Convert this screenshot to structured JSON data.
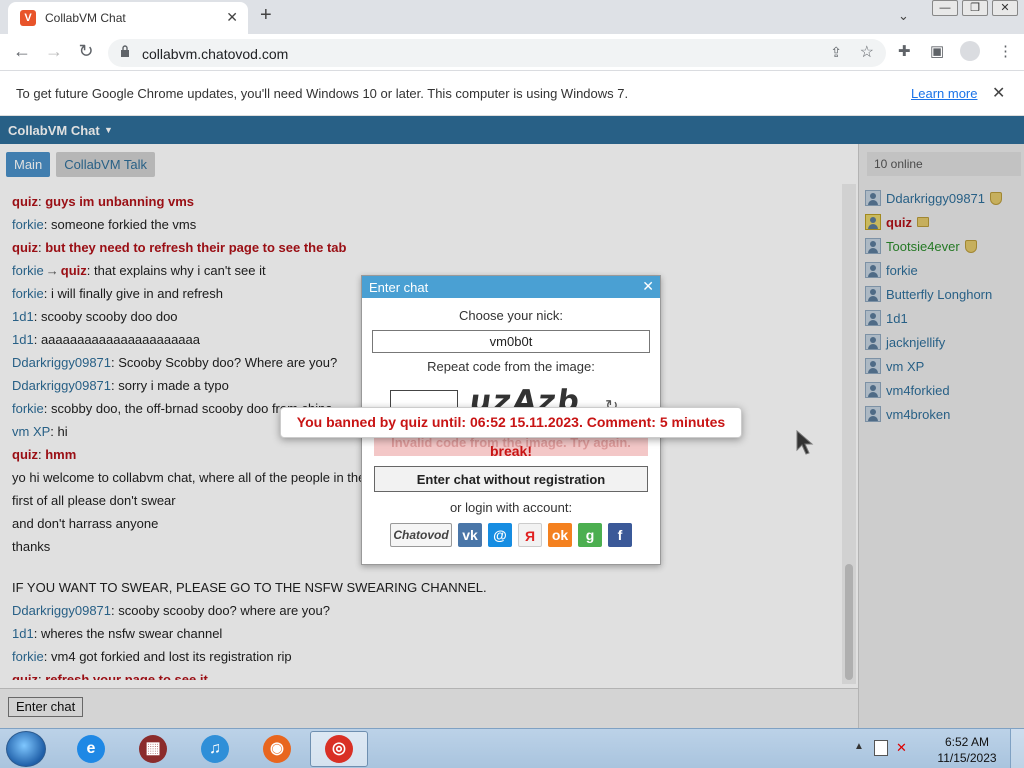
{
  "browser": {
    "tab_title": "CollabVM Chat",
    "tab_close": "✕",
    "new_tab": "+",
    "url": "collabvm.chatovod.com",
    "window_controls": [
      "—",
      "❐",
      "✕"
    ]
  },
  "infobar": {
    "message": "To get future Google Chrome updates, you'll need Windows 10 or later. This computer is using Windows 7.",
    "learn_more": "Learn more",
    "close": "✕"
  },
  "app": {
    "title": "CollabVM Chat",
    "tabs": [
      {
        "label": "Main",
        "active": true
      },
      {
        "label": "CollabVM Talk",
        "active": false
      }
    ],
    "enter_chat_button": "Enter chat",
    "online_count": "10 online"
  },
  "messages": [
    {
      "nick": "quiz",
      "sep": ": ",
      "text": "guys im unbanning vms",
      "style": "red"
    },
    {
      "nick": "forkie",
      "sep": ": ",
      "text": "someone forkied the vms",
      "style": "normal"
    },
    {
      "nick": "quiz",
      "sep": ": ",
      "text": "but they need to refresh their page to see the tab",
      "style": "red"
    },
    {
      "nick": "forkie",
      "arrow": "→",
      "to": "quiz",
      "sep": ": ",
      "text": "that explains why i can't see it",
      "style": "normal"
    },
    {
      "nick": "forkie",
      "sep": ": ",
      "text": "i will finally give in and refresh",
      "style": "normal"
    },
    {
      "nick": "1d1",
      "sep": ": ",
      "text": "scooby scooby doo doo",
      "style": "normal"
    },
    {
      "nick": "1d1",
      "sep": ": ",
      "text": "aaaaaaaaaaaaaaaaaaaaaa",
      "style": "normal"
    },
    {
      "nick": "Ddarkriggy09871",
      "sep": ": ",
      "text": "Scooby Scobby doo? Where are you?",
      "style": "normal"
    },
    {
      "nick": "Ddarkriggy09871",
      "sep": ": ",
      "text": "sorry i made a typo",
      "style": "normal"
    },
    {
      "nick": "forkie",
      "sep": ": ",
      "text": "scobby doo, the off-brnad scooby doo from china",
      "style": "normal"
    },
    {
      "nick": "vm XP",
      "sep": ": ",
      "text": "hi",
      "style": "normal"
    },
    {
      "nick": "quiz",
      "sep": ": ",
      "text": "hmm",
      "style": "red"
    },
    {
      "nick": "",
      "sep": "",
      "text": "yo hi welcome to collabvm chat, where all of the people in the",
      "style": "plain"
    },
    {
      "nick": "",
      "sep": "",
      "text": "first of all please don't swear",
      "style": "plain"
    },
    {
      "nick": "",
      "sep": "",
      "text": "and don't harrass anyone",
      "style": "plain"
    },
    {
      "nick": "",
      "sep": "",
      "text": "thanks",
      "style": "plain"
    },
    {
      "nick": "",
      "sep": "",
      "text": "",
      "style": "gap"
    },
    {
      "nick": "",
      "sep": "",
      "text": "IF YOU WANT TO SWEAR, PLEASE GO TO THE NSFW SWEARING CHANNEL.",
      "style": "plain"
    },
    {
      "nick": "Ddarkriggy09871",
      "sep": ": ",
      "text": "scooby scooby doo? where are you?",
      "style": "normal"
    },
    {
      "nick": "1d1",
      "sep": ": ",
      "text": "wheres the nsfw swear channel",
      "style": "normal"
    },
    {
      "nick": "forkie",
      "sep": ": ",
      "text": "vm4 got forkied and lost its registration rip",
      "style": "normal"
    },
    {
      "nick": "quiz",
      "sep": ": ",
      "text": "refresh your page to see it",
      "style": "red"
    }
  ],
  "users": [
    {
      "name": "Ddarkriggy09871",
      "style": "normal",
      "badge": "shield"
    },
    {
      "name": "quiz",
      "style": "red",
      "badge": "crown"
    },
    {
      "name": "Tootsie4ever",
      "style": "green",
      "badge": "shield"
    },
    {
      "name": "forkie",
      "style": "normal",
      "badge": ""
    },
    {
      "name": "Butterfly Longhorn",
      "style": "normal",
      "badge": ""
    },
    {
      "name": "1d1",
      "style": "normal",
      "badge": ""
    },
    {
      "name": "jacknjellify",
      "style": "normal",
      "badge": ""
    },
    {
      "name": "vm XP",
      "style": "normal",
      "badge": ""
    },
    {
      "name": "vm4forkied",
      "style": "normal",
      "badge": ""
    },
    {
      "name": "vm4broken",
      "style": "normal",
      "badge": ""
    }
  ],
  "dialog": {
    "title": "Enter chat",
    "close": "✕",
    "nick_label": "Choose your nick:",
    "nick_value": "vm0b0t",
    "captcha_label": "Repeat code from the image:",
    "captcha_text": "uzAzb",
    "invalid_msg": "Invalid code from the image. Try again.",
    "enter_no_reg": "Enter chat without registration",
    "or_login": "or login with account:",
    "socials": [
      {
        "name": "chatovod",
        "label": "Chatovod",
        "color": "#f5f5f5"
      },
      {
        "name": "vk",
        "label": "vk",
        "color": "#4a76a8"
      },
      {
        "name": "mailru",
        "label": "@",
        "color": "#168de2"
      },
      {
        "name": "yandex",
        "label": "Я",
        "color": "#f2f2f2"
      },
      {
        "name": "odnoklassniki",
        "label": "ok",
        "color": "#f4811f"
      },
      {
        "name": "google",
        "label": "g",
        "color": "#4caf50"
      },
      {
        "name": "facebook",
        "label": "f",
        "color": "#3b5998"
      }
    ]
  },
  "ban_message": "You banned by quiz until: 06:52 15.11.2023. Comment: 5 minutes break!",
  "taskbar": {
    "apps": [
      {
        "name": "internet-explorer",
        "color": "#1e88e5",
        "glyph": "e",
        "active": false
      },
      {
        "name": "media-center",
        "color": "#8b2c2c",
        "glyph": "▦",
        "active": false
      },
      {
        "name": "itunes",
        "color": "#2f8fd8",
        "glyph": "♫",
        "active": false
      },
      {
        "name": "firefox",
        "color": "#e8661f",
        "glyph": "◉",
        "active": false
      },
      {
        "name": "chrome",
        "color": "#d93025",
        "glyph": "◎",
        "active": true
      }
    ],
    "time": "6:52 AM",
    "date": "11/15/2023"
  },
  "colors": {
    "app_header": "#2e6e99",
    "nick": "#2e6e99",
    "admin_red": "#b01218",
    "ban_red": "#c81414"
  }
}
